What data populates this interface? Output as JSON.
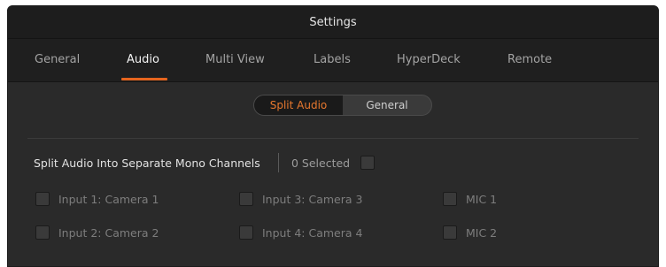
{
  "window": {
    "title": "Settings"
  },
  "tabs": [
    {
      "label": "General",
      "active": false
    },
    {
      "label": "Audio",
      "active": true
    },
    {
      "label": "Multi View",
      "active": false
    },
    {
      "label": "Labels",
      "active": false
    },
    {
      "label": "HyperDeck",
      "active": false
    },
    {
      "label": "Remote",
      "active": false
    }
  ],
  "segmented": {
    "options": [
      "Split Audio",
      "General"
    ],
    "selected": "Split Audio"
  },
  "split_audio": {
    "label": "Split Audio Into Separate Mono Channels",
    "selected_count_text": "0 Selected",
    "inputs": [
      {
        "label": "Input 1: Camera 1",
        "checked": false
      },
      {
        "label": "Input 2: Camera 2",
        "checked": false
      },
      {
        "label": "Input 3: Camera 3",
        "checked": false
      },
      {
        "label": "Input 4: Camera 4",
        "checked": false
      },
      {
        "label": "MIC 1",
        "checked": false
      },
      {
        "label": "MIC 2",
        "checked": false
      }
    ]
  },
  "colors": {
    "accent": "#e5641e",
    "window_bg": "#2a2a2a",
    "titlebar_bg": "#1d1d1d"
  }
}
